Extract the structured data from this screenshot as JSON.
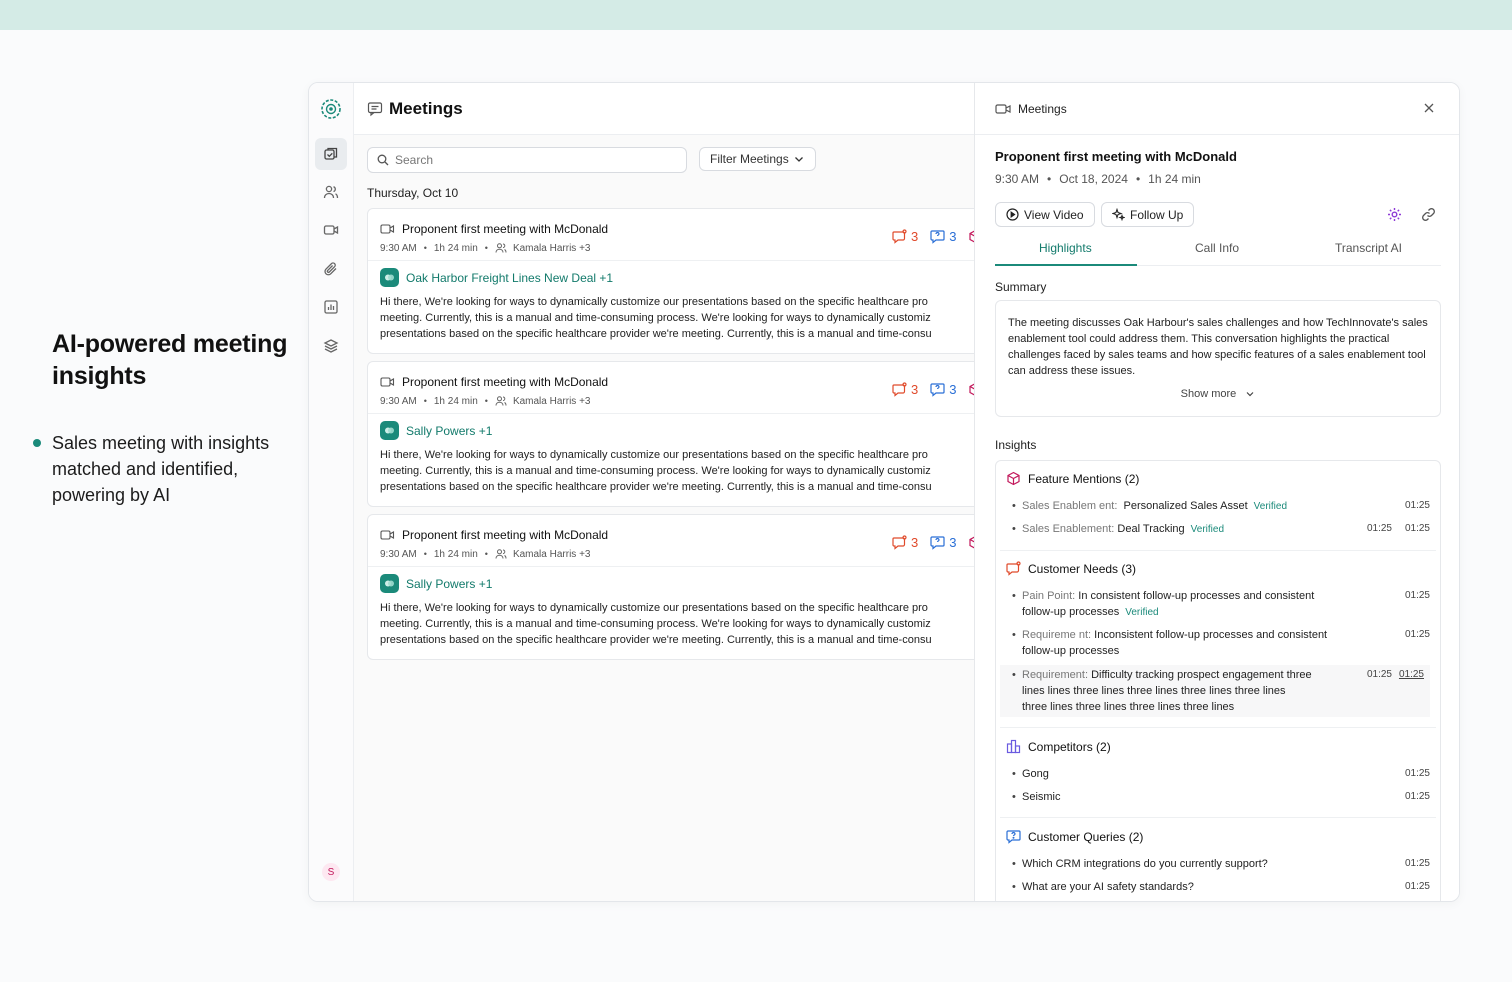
{
  "promo": {
    "heading": "AI-powered meeting insights",
    "bullet": "Sales meeting with insights matched and identified, powering by AI"
  },
  "rail": {
    "user_initial": "S"
  },
  "list": {
    "title": "Meetings",
    "search_placeholder": "Search",
    "filter_label": "Filter Meetings",
    "date_label": "Thursday, Oct 10",
    "cards": [
      {
        "title": "Proponent first meeting with McDonald",
        "time": "9:30 AM",
        "duration": "1h 24 min",
        "attendees": "Kamala Harris +3",
        "deal": "Oak Harbor Freight Lines New Deal +1",
        "count_needs": "3",
        "count_queries": "3",
        "body": [
          "Hi there, We're looking for ways to dynamically customize our presentations based on the specific healthcare pro",
          "meeting. Currently, this is a manual and time-consuming process. We're looking for ways to dynamically customiz",
          "presentations based on the specific healthcare provider we're meeting. Currently, this is a manual and time-consu"
        ]
      },
      {
        "title": "Proponent first meeting with McDonald",
        "time": "9:30 AM",
        "duration": "1h 24 min",
        "attendees": "Kamala Harris +3",
        "deal": "Sally Powers +1",
        "count_needs": "3",
        "count_queries": "3",
        "body": [
          "Hi there, We're looking for ways to dynamically customize our presentations based on the specific healthcare pro",
          "meeting. Currently, this is a manual and time-consuming process. We're looking for ways to dynamically customiz",
          "presentations based on the specific healthcare provider we're meeting. Currently, this is a manual and time-consu"
        ]
      },
      {
        "title": "Proponent first meeting with McDonald",
        "time": "9:30 AM",
        "duration": "1h 24 min",
        "attendees": "Kamala Harris +3",
        "deal": "Sally Powers +1",
        "count_needs": "3",
        "count_queries": "3",
        "body": [
          "Hi there, We're looking for ways to dynamically customize our presentations based on the specific healthcare pro",
          "meeting. Currently, this is a manual and time-consuming process. We're looking for ways to dynamically customiz",
          "presentations based on the specific healthcare provider we're meeting. Currently, this is a manual and time-consu"
        ]
      }
    ]
  },
  "detail": {
    "header": "Meetings",
    "title": "Proponent first meeting with McDonald",
    "time": "9:30 AM",
    "date": "Oct 18, 2024",
    "duration": "1h 24 min",
    "view_video": "View Video",
    "follow_up": "Follow Up",
    "tabs": [
      "Highlights",
      "Call Info",
      "Transcript AI"
    ],
    "summary_label": "Summary",
    "summary_text": "The meeting discusses Oak Harbour's sales challenges and how TechInnovate's sales enablement tool could address them. This conversation highlights the practical challenges faced by sales teams and how specific features of a sales enablement tool can address these issues.",
    "show_more": "Show more",
    "insights_label": "Insights",
    "feature": {
      "title": "Feature Mentions (2)",
      "r1_key": "Sales Enablem ent:",
      "r1_val": "Personalized Sales Asset",
      "r1_badge": "Verified",
      "r1_ts": "01:25",
      "r2_key": "Sales Enablement:",
      "r2_val": "Deal Tracking",
      "r2_badge": "Verified",
      "r2_ts1": "01:25",
      "r2_ts2": "01:25"
    },
    "needs": {
      "title": "Customer Needs (3)",
      "r1_key": "Pain Point:",
      "r1_val": "In consistent follow-up processes and consistent",
      "r1_val2": "follow-up processes",
      "r1_badge": "Verified",
      "r1_ts": "01:25",
      "r2_key": "Requireme nt:",
      "r2_val": "Inconsistent follow-up processes and consistent",
      "r2_val2": "follow-up processes",
      "r2_ts": "01:25",
      "r3_key": "Requirement:",
      "r3_val": "Difficulty tracking prospect engagement three",
      "r3_val2": "lines   lines three lines three lines three lines three lines",
      "r3_val3": "three lines three lines three lines three lines",
      "r3_ts1": "01:25",
      "r3_ts2": "01:25"
    },
    "competitors": {
      "title": "Competitors (2)",
      "r1": "Gong",
      "r1_ts": "01:25",
      "r2": "Seismic",
      "r2_ts": "01:25"
    },
    "queries": {
      "title": "Customer Queries (2)",
      "r1": "Which CRM integrations do you currently support?",
      "r1_ts": "01:25",
      "r2": "What are your AI safety standards?",
      "r2_ts": "01:25"
    }
  }
}
